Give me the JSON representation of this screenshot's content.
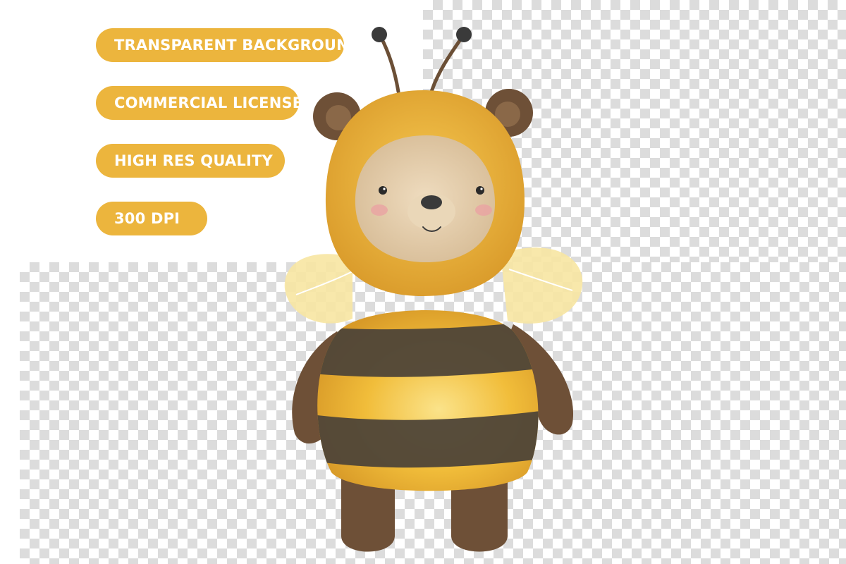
{
  "badges": [
    {
      "label": "TRANSPARENT BACKGROUND"
    },
    {
      "label": "COMMERCIAL LICENSE"
    },
    {
      "label": "HIGH RES QUALITY"
    },
    {
      "label": "300 DPI"
    }
  ],
  "illustration": {
    "subject": "teddy-bear-in-bee-costume",
    "colors": {
      "badge": "#ecb53d",
      "costume_yellow": "#f2bd3a",
      "costume_stripe": "#4e4538",
      "bear_brown": "#6e5037",
      "bear_face": "#e6d0b0",
      "wing": "#f7e6a2"
    }
  }
}
